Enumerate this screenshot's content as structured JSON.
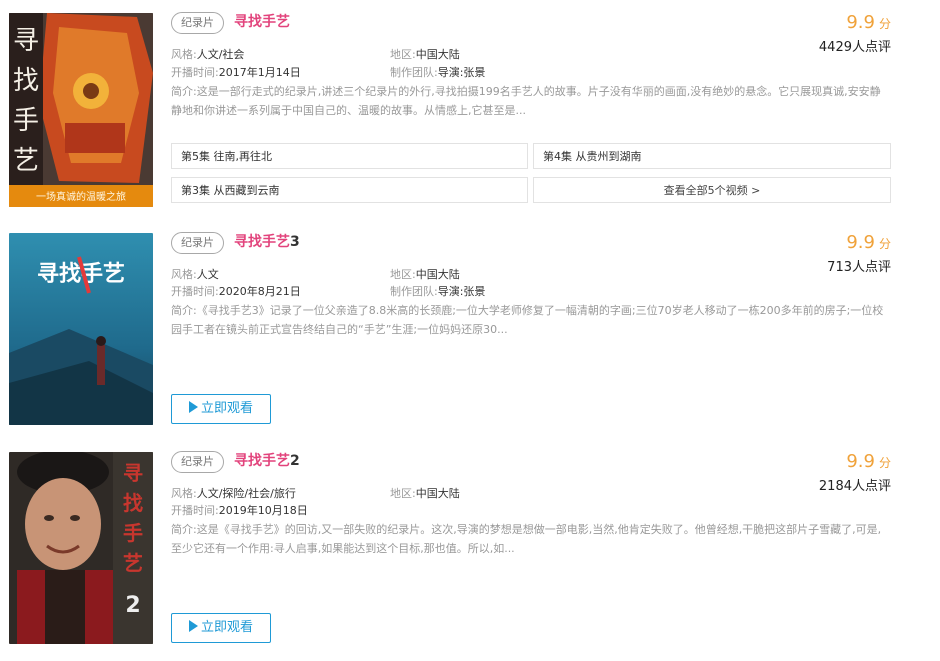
{
  "results": [
    {
      "poster_text": [
        "寻",
        "找",
        "手",
        "艺"
      ],
      "poster_caption": "一场真诚的温暖之旅",
      "tag": "纪录片",
      "title_highlight": "寻找手艺",
      "title_suffix": "",
      "score": "9.9",
      "score_unit": "分",
      "review_count": "4429人点评",
      "genre_label": "风格:",
      "genre": "人文/社会",
      "region_label": "地区:",
      "region": "中国大陆",
      "date_label": "开播时间:",
      "date": "2017年1月14日",
      "team_label": "制作团队:",
      "team": "导演:张景",
      "desc": "简介:这是一部行走式的纪录片,讲述三个纪录片的外行,寻找拍摄199名手艺人的故事。片子没有华丽的画面,没有绝妙的悬念。它只展现真诚,安安静静地和你讲述一系列属于中国自己的、温暖的故事。从情感上,它甚至是...",
      "episodes": [
        "第5集 往南,再往北",
        "第4集 从贵州到湖南",
        "第3集 从西藏到云南"
      ],
      "view_all": "查看全部5个视频 >"
    },
    {
      "poster_text": [
        "寻找手艺"
      ],
      "poster_caption": "",
      "tag": "纪录片",
      "title_highlight": "寻找手艺",
      "title_suffix": "3",
      "score": "9.9",
      "score_unit": "分",
      "review_count": "713人点评",
      "genre_label": "风格:",
      "genre": "人文",
      "region_label": "地区:",
      "region": "中国大陆",
      "date_label": "开播时间:",
      "date": "2020年8月21日",
      "team_label": "制作团队:",
      "team": "导演:张景",
      "desc": "简介:《寻找手艺3》记录了一位父亲造了8.8米高的长颈鹿;一位大学老师修复了一幅清朝的字画;三位70岁老人移动了一栋200多年前的房子;一位校园手工者在镜头前正式宣告终结自己的“手艺”生涯;一位妈妈还原30...",
      "watch_label": "立即观看"
    },
    {
      "poster_text": [
        "寻",
        "找",
        "手",
        "艺",
        "2"
      ],
      "poster_caption": "",
      "tag": "纪录片",
      "title_highlight": "寻找手艺",
      "title_suffix": "2",
      "score": "9.9",
      "score_unit": "分",
      "review_count": "2184人点评",
      "genre_label": "风格:",
      "genre": "人文/探险/社会/旅行",
      "region_label": "地区:",
      "region": "中国大陆",
      "date_label": "开播时间:",
      "date": "2019年10月18日",
      "desc": "简介:这是《寻找手艺》的回访,又一部失败的纪录片。这次,导演的梦想是想做一部电影,当然,他肯定失败了。他曾经想,干脆把这部片子雪藏了,可是,至少它还有一个作用:寻人启事,如果能达到这个目标,那也值。所以,如...",
      "watch_label": "立即观看"
    }
  ],
  "colors": {
    "highlight": "#e2437c",
    "score": "#f0a23a",
    "watch": "#1f9ad6"
  }
}
